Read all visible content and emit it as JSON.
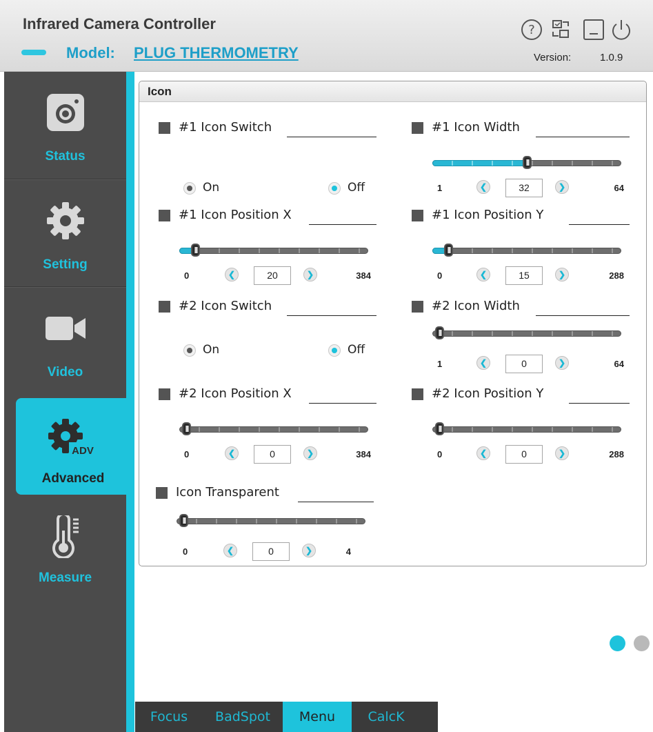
{
  "header": {
    "title": "Infrared Camera Controller",
    "model_label": "Model:",
    "model_value": "PLUG THERMOMETRY",
    "version_label": "Version:",
    "version_value": "1.0.9",
    "icons": [
      "help-icon",
      "device-sync-icon",
      "minimize-icon",
      "power-icon"
    ]
  },
  "sidebar": {
    "items": [
      {
        "label": "Status",
        "icon": "camera-icon"
      },
      {
        "label": "Setting",
        "icon": "gear-icon"
      },
      {
        "label": "Video",
        "icon": "video-camera-icon"
      },
      {
        "label": "Advanced",
        "icon": "gear-adv-icon",
        "badge": "ADV",
        "selected": true
      },
      {
        "label": "Measure",
        "icon": "thermometer-icon"
      }
    ]
  },
  "panel": {
    "title": "Icon",
    "controls": [
      {
        "label": "#1 Icon Switch",
        "type": "radio",
        "options": [
          {
            "label": "On",
            "selected": true
          },
          {
            "label": "Off",
            "selected": false
          }
        ]
      },
      {
        "label": "#1 Icon Width",
        "type": "slider",
        "min": "1",
        "max": "64",
        "value": "32",
        "level": 0.5
      },
      {
        "label": "#1 Icon Position X",
        "type": "slider",
        "min": "0",
        "max": "384",
        "value": "20",
        "level": 0.052
      },
      {
        "label": "#1 Icon Position Y",
        "type": "slider",
        "min": "0",
        "max": "288",
        "value": "15",
        "level": 0.052
      },
      {
        "label": "#2 Icon Switch",
        "type": "radio",
        "options": [
          {
            "label": "On",
            "selected": true
          },
          {
            "label": "Off",
            "selected": false
          }
        ]
      },
      {
        "label": "#2 Icon Width",
        "type": "slider",
        "min": "1",
        "max": "64",
        "value": "0",
        "level": 0
      },
      {
        "label": "#2 Icon Position X",
        "type": "slider",
        "min": "0",
        "max": "384",
        "value": "0",
        "level": 0
      },
      {
        "label": "#2 Icon Position Y",
        "type": "slider",
        "min": "0",
        "max": "288",
        "value": "0",
        "level": 0
      },
      {
        "label": "Icon Transparent",
        "type": "slider",
        "min": "0",
        "max": "4",
        "value": "0",
        "level": 0
      }
    ]
  },
  "bottom_tabs": [
    {
      "label": "Focus",
      "active": false
    },
    {
      "label": "BadSpot",
      "active": false
    },
    {
      "label": "Menu",
      "active": true
    },
    {
      "label": "CalcK",
      "active": false
    }
  ],
  "pager": {
    "pages": 2,
    "current": 1
  },
  "colors": {
    "accent": "#1ec3dc",
    "sidebar": "#4b4b4b",
    "label_cyan": "#20c2dd"
  }
}
